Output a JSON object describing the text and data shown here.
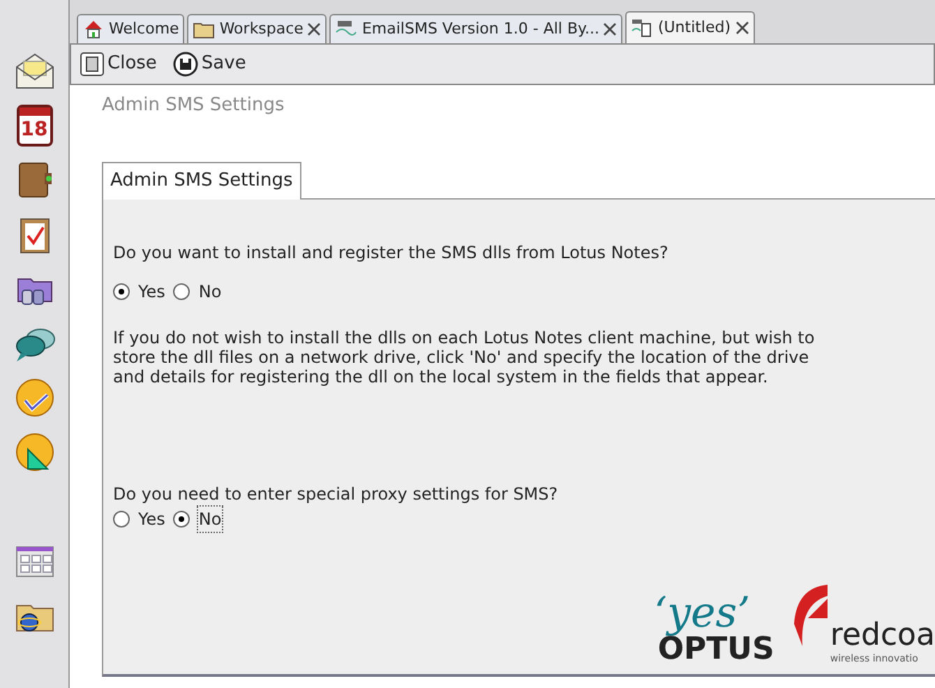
{
  "sidebar": {
    "items": [
      {
        "kind": "envelope"
      },
      {
        "kind": "calendar",
        "label": "18"
      },
      {
        "kind": "book"
      },
      {
        "kind": "clipboard"
      },
      {
        "kind": "folders"
      },
      {
        "kind": "chat"
      },
      {
        "kind": "check"
      },
      {
        "kind": "triangle"
      },
      {
        "kind": "spacer"
      },
      {
        "kind": "grid"
      },
      {
        "kind": "folder"
      }
    ]
  },
  "tabs": [
    {
      "label": "Welcome",
      "kind": "home",
      "closable": false,
      "selected": false
    },
    {
      "label": "Workspace",
      "kind": "folder",
      "closable": true,
      "selected": false
    },
    {
      "label": "EmailSMS Version 1.0 - All By...",
      "kind": "sms",
      "closable": true,
      "selected": false
    },
    {
      "label": "(Untitled)",
      "kind": "doc",
      "closable": true,
      "selected": true
    }
  ],
  "toolbar": {
    "buttons": [
      {
        "label": "Close",
        "kind": "close"
      },
      {
        "label": "Save",
        "kind": "save"
      }
    ]
  },
  "form": {
    "title": "Admin SMS Settings",
    "section_tab": "Admin SMS Settings",
    "questions": [
      {
        "text": "Do you want to install and register the SMS dlls from Lotus Notes?",
        "options": [
          {
            "label": "Yes",
            "selected": true
          },
          {
            "label": "No",
            "selected": false
          }
        ]
      },
      {
        "text": "Do you need to enter special proxy settings for SMS?",
        "options": [
          {
            "label": "Yes",
            "selected": false
          },
          {
            "label": "No",
            "selected": true,
            "focused": true
          }
        ]
      }
    ],
    "note": "If you do not wish to install the dlls on each Lotus Notes client machine, but wish to store the dll files on a network drive, click 'No' and specify the location of the drive and details for registering the dll on the local system in the fields that appear."
  },
  "logos": {
    "optus_slogan": "‘yes’",
    "optus_name": "OPTUS",
    "redcoat_name": "redcoa",
    "redcoat_tagline": "wireless innovatio"
  }
}
